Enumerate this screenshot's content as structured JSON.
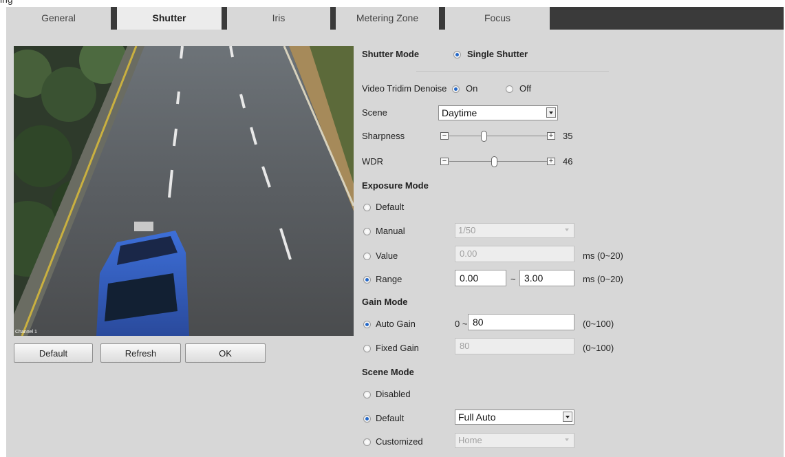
{
  "header": {
    "title_fragment": "ing"
  },
  "tabs": [
    "General",
    "Shutter",
    "Iris",
    "Metering Zone",
    "Focus"
  ],
  "buttons": {
    "default": "Default",
    "refresh": "Refresh",
    "ok": "OK"
  },
  "video": {
    "top_right_overlay": "",
    "bottom_left_overlay": "Channel 1"
  },
  "shutter_mode": {
    "label": "Shutter Mode",
    "option": "Single Shutter"
  },
  "denoise": {
    "label": "Video Tridim Denoise",
    "on": "On",
    "off": "Off"
  },
  "scene": {
    "label": "Scene",
    "value": "Daytime"
  },
  "sharpness": {
    "label": "Sharpness",
    "value": "35",
    "level": 35
  },
  "wdr": {
    "label": "WDR",
    "value": "46",
    "level": 46
  },
  "exposure": {
    "title": "Exposure Mode",
    "default_label": "Default",
    "manual_label": "Manual",
    "manual_value": "1/50",
    "value_label": "Value",
    "value_value": "0.00",
    "value_unit": "ms (0~20)",
    "range_label": "Range",
    "range_min": "0.00",
    "range_sep": "~",
    "range_max": "3.00",
    "range_unit": "ms (0~20)"
  },
  "gain": {
    "title": "Gain Mode",
    "auto_label": "Auto Gain",
    "auto_prefix": "0 ~",
    "auto_value": "80",
    "auto_unit": "(0~100)",
    "fixed_label": "Fixed Gain",
    "fixed_value": "80",
    "fixed_unit": "(0~100)"
  },
  "scene_mode": {
    "title": "Scene Mode",
    "disabled_label": "Disabled",
    "default_label": "Default",
    "default_value": "Full Auto",
    "custom_label": "Customized",
    "custom_value": "Home"
  },
  "colors": {
    "accent": "#2468c8",
    "panel": "#d7d7d7",
    "tab_bg": "#3a3a3a"
  }
}
